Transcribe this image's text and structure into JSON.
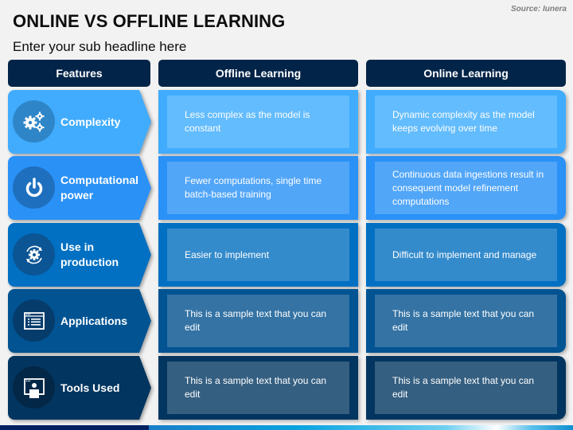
{
  "header": {
    "title": "ONLINE VS OFFLINE LEARNING",
    "subtitle": "Enter your sub headline here",
    "source": "Source: Iunera"
  },
  "table": {
    "columns": [
      "Features",
      "Offline Learning",
      "Online Learning"
    ],
    "rows": [
      {
        "feature": "Complexity",
        "icon": "gears-icon",
        "offline": "Less complex as the model is constant",
        "online": "Dynamic complexity as the model keeps evolving over time",
        "colors": {
          "base": "#41acfd",
          "inner": "#63bcfd",
          "circle": "#2e86c8"
        }
      },
      {
        "feature": "Computational power",
        "icon": "power-icon",
        "offline": "Fewer computations, single time batch-based training",
        "online": "Continuous data ingestions result in consequent model refinement computations",
        "colors": {
          "base": "#2a91f7",
          "inner": "#52a6f8",
          "circle": "#1e6fbe"
        }
      },
      {
        "feature": "Use in production",
        "icon": "gear-cycle-icon",
        "offline": "Easier to implement",
        "online": "Difficult to implement and manage",
        "colors": {
          "base": "#0170c2",
          "inner": "#348bcc",
          "circle": "#0b5595"
        }
      },
      {
        "feature": "Applications",
        "icon": "app-window-list-icon",
        "offline": "This is a sample text that you can edit",
        "online": "This is a sample text that you can edit",
        "colors": {
          "base": "#015392",
          "inner": "#3473a4",
          "circle": "#063c6c"
        }
      },
      {
        "feature": "Tools Used",
        "icon": "presenter-screen-icon",
        "offline": "This is a sample text that you can edit",
        "online": "This is a sample text that you can edit",
        "colors": {
          "base": "#02355f",
          "inner": "#355f81",
          "circle": "#032747"
        }
      }
    ]
  }
}
